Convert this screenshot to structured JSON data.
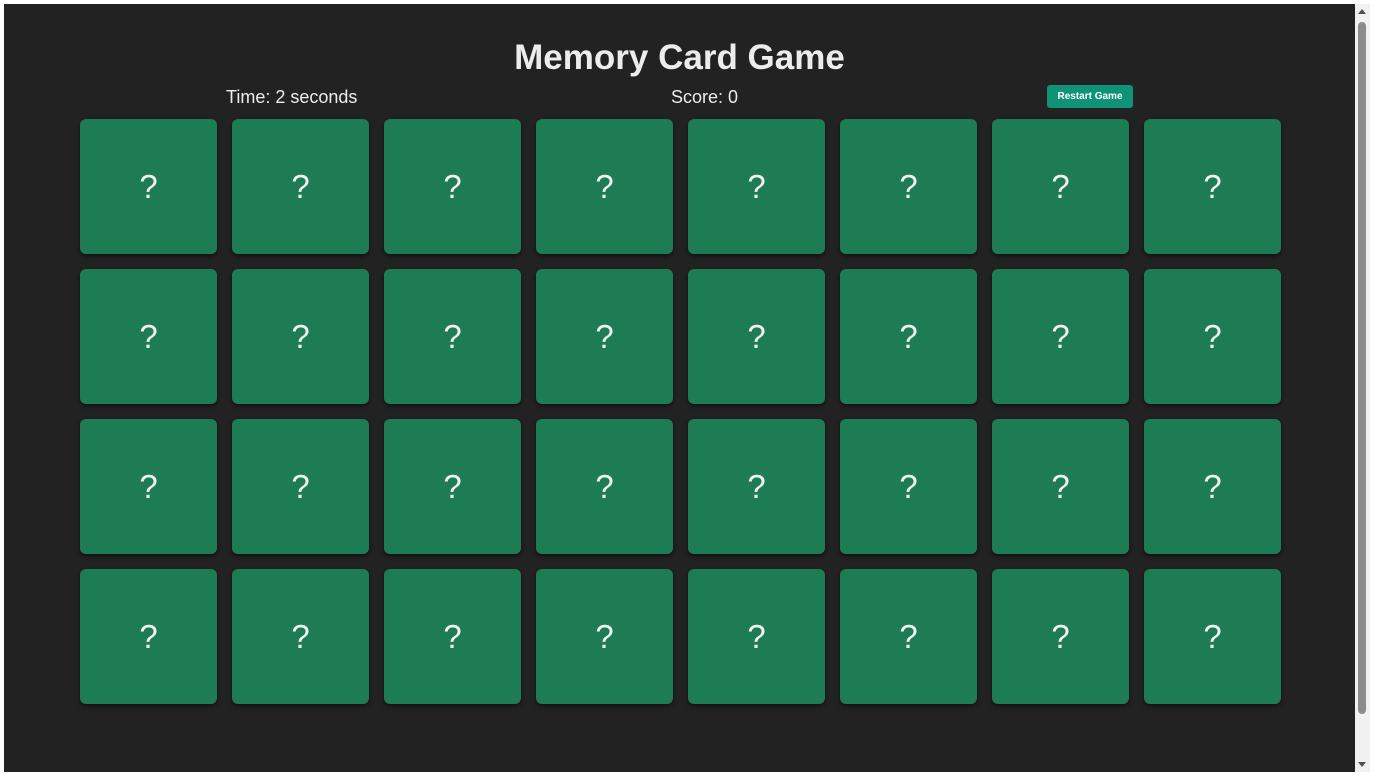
{
  "game": {
    "title": "Memory Card Game",
    "time_text": "Time: 2 seconds",
    "score_text": "Score: 0",
    "restart_label": "Restart Game"
  },
  "board": {
    "rows": 4,
    "columns": 8,
    "card_face": "?",
    "card_color": "#1e7c55",
    "background_color": "#222222",
    "button_color": "#0f9377"
  }
}
